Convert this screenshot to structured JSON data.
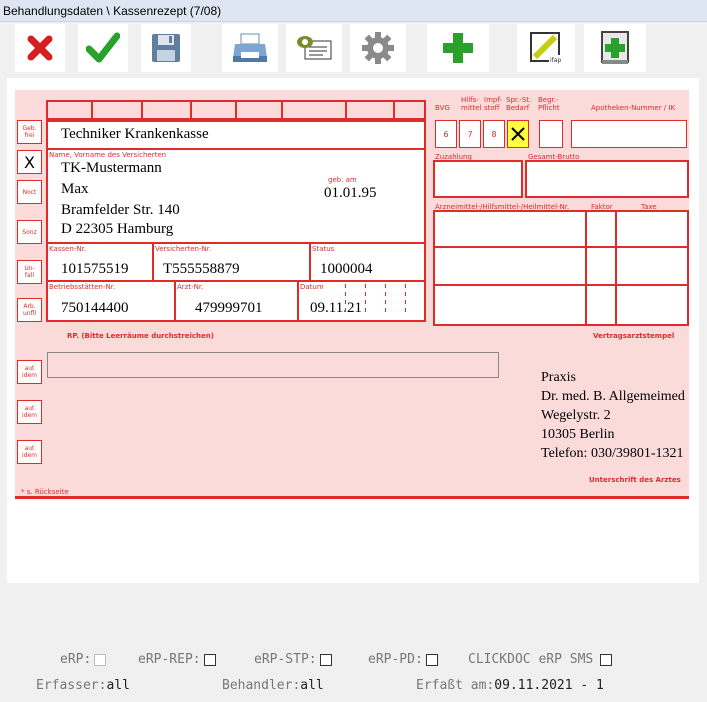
{
  "window": {
    "title": "Behandlungsdaten \\ Kassenrezept (7/08)"
  },
  "toolbar": {
    "icons": [
      "close-icon",
      "check-icon",
      "save-icon",
      "print-icon",
      "view-card-icon",
      "settings-gear-icon",
      "add-plus-icon",
      "ifap-icon",
      "medication-book-icon"
    ]
  },
  "form": {
    "side_labels": [
      "Geb.\nfrei",
      "X",
      "Noct",
      "Sonz",
      "Un-\nfall",
      "Arb.\nunfll"
    ],
    "aut_idem": [
      "aut\nidem",
      "aut\nidem",
      "aut\nidem"
    ],
    "header_labels": {
      "bvg": "BVG",
      "hilfsmittel": "Hilfs-\nmittel",
      "impfstoff": "Impf-\nstoff",
      "spr_st_bedarf": "Spr.-St.\nBedarf",
      "begr_pflicht": "Begr.-\nPflicht",
      "apotheken": "Apotheken-Nummer / IK",
      "zuzahlung": "Zuzahlung",
      "gesamt_brutto": "Gesamt-Brutto",
      "arzneimittel": "Arzneimittel-/Hilfsmittel-/Heilmittel-Nr.",
      "faktor": "Faktor",
      "taxe": "Taxe",
      "name": "Name, Vorname des Versicherten",
      "geb_am": "geb. am",
      "kassen_nr": "Kassen-Nr.",
      "versicherten_nr": "Versicherten-Nr.",
      "status": "Status",
      "betriebsstaetten_nr": "Betriebsstätten-Nr.",
      "arzt_nr": "Arzt-Nr.",
      "datum": "Datum",
      "rp": "RP.  (Bitte Leerräume durchstreichen)",
      "vertragsarztstempel": "Vertragsarztstempel",
      "unterschrift": "Unterschrift des Arztes",
      "bei_arbeitsunfall": "* s. Rückseite"
    },
    "numbered_cells": [
      "6",
      "7",
      "8"
    ],
    "values": {
      "krankenkasse": "Techniker Krankenkasse",
      "name_line1": "TK-Mustermann",
      "name_line2": "Max",
      "address_line1": "Bramfelder Str. 140",
      "address_line2": "D 22305 Hamburg",
      "geb_am": "01.01.95",
      "kassen_nr": "101575519",
      "versicherten_nr": "T555558879",
      "status": "1000004",
      "betriebsstaetten_nr": "750144400",
      "arzt_nr": "479999701",
      "datum": "09.11.21"
    },
    "stamp": [
      "Praxis",
      "Dr. med. B. Allgemeimed",
      "Wegelystr. 2",
      "10305 Berlin",
      "Telefon: 030/39801-1321"
    ]
  },
  "bottom": {
    "erp": "eRP:",
    "erp_rep": "eRP-REP:",
    "erp_stp": "eRP-STP:",
    "erp_pd": "eRP-PD:",
    "clickdoc": "CLICKDOC eRP SMS",
    "erfasser_label": "Erfasser:",
    "erfasser_value": "all",
    "behandler_label": "Behandler:",
    "behandler_value": "all",
    "erfasst_label": "Erfaßt am:",
    "erfasst_value": "09.11.2021 - 1"
  },
  "colors": {
    "form_red": "#e02b2b",
    "form_bg": "#fbdada",
    "green": "#2aa12a"
  }
}
